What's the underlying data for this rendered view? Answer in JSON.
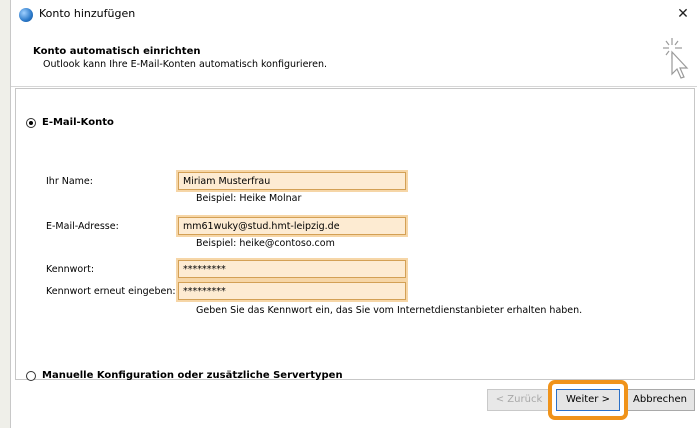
{
  "window": {
    "title": "Konto hinzufügen",
    "close_label": "✕"
  },
  "header": {
    "title": "Konto automatisch einrichten",
    "subtitle": "Outlook kann Ihre E-Mail-Konten automatisch konfigurieren."
  },
  "form": {
    "option_email": "E-Mail-Konto",
    "name_label": "Ihr Name:",
    "name_value": "Miriam Musterfrau",
    "name_hint": "Beispiel: Heike Molnar",
    "email_label": "E-Mail-Adresse:",
    "email_value": "mm61wuky@stud.hmt-leipzig.de",
    "email_hint": "Beispiel: heike@contoso.com",
    "password_label": "Kennwort:",
    "password_value": "*********",
    "password_repeat_label": "Kennwort erneut eingeben:",
    "password_repeat_value": "*********",
    "password_hint": "Geben Sie das Kennwort ein, das Sie vom Internetdienstanbieter erhalten haben.",
    "option_manual": "Manuelle Konfiguration oder zusätzliche Servertypen"
  },
  "buttons": {
    "back": "< Zurück",
    "next": "Weiter >",
    "cancel": "Abbrechen"
  },
  "colors": {
    "field_highlight": "#fdebd2",
    "field_border": "#d3a055",
    "next_highlight": "#f0931a"
  }
}
